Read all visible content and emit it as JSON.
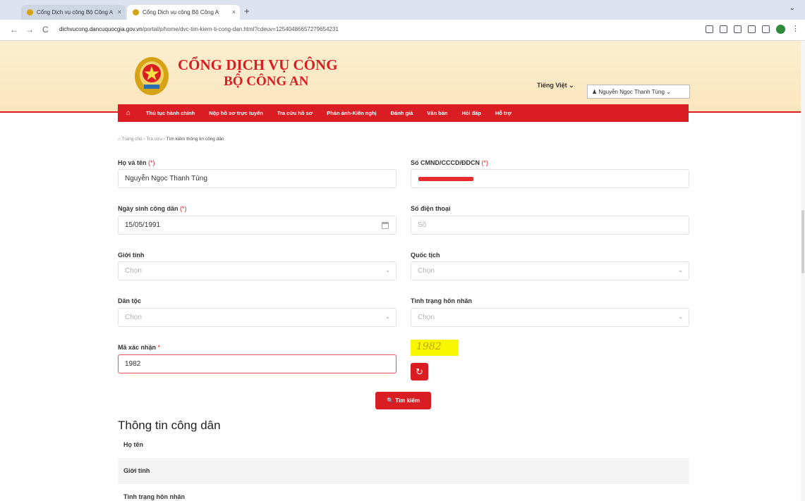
{
  "browser": {
    "tabs": [
      {
        "title": "Cổng Dịch vụ công Bộ Công A"
      },
      {
        "title": "Cổng Dịch vụ công Bộ Công A"
      }
    ],
    "close_glyph": "×",
    "new_tab_glyph": "+",
    "url_host": "dichvucong.dancuquocgia.gov.vn",
    "url_path": "/portal/p/home/dvc-tim-kiem-ti-cong-dan.html?cdeuv=12540486657279654231",
    "back_glyph": "←",
    "forward_glyph": "→",
    "reload_glyph": "C",
    "menu_glyph": "⌄"
  },
  "site": {
    "title_line1": "CỔNG DỊCH VỤ CÔNG",
    "title_line2": "BỘ CÔNG AN",
    "language": "Tiếng Việt ⌄",
    "user": "♟ Nguyễn Ngọc Thanh Tùng ⌄",
    "colors": {
      "brand_red": "#d91d23",
      "header_bg": "#fbeed0",
      "captcha_bg": "#f9f700"
    }
  },
  "nav": {
    "home_icon": "⌂",
    "items": [
      "Thủ tục hành chính",
      "Nộp hồ sơ trực tuyến",
      "Tra cứu hồ sơ",
      "Phản ánh-Kiến nghị",
      "Đánh giá",
      "Văn bản",
      "Hỏi đáp",
      "Hỗ trợ"
    ]
  },
  "breadcrumb": {
    "home": "⌂ Trang chủ",
    "sep": "›",
    "level2": "Tra cứu",
    "current": "Tìm kiếm thông tin công dân"
  },
  "form": {
    "full_name": {
      "label": "Họ và tên",
      "required_mark": "(*)",
      "value": "Nguyễn Ngọc Thanh Tùng"
    },
    "id_number": {
      "label": "Số CMND/CCCD/ĐDCN",
      "required_mark": "(*)"
    },
    "birth_date": {
      "label": "Ngày sinh công dân",
      "required_mark": "(*)",
      "value": "15/05/1991"
    },
    "phone": {
      "label": "Số điện thoại",
      "placeholder": "Số"
    },
    "gender": {
      "label": "Giới tính",
      "placeholder": "Chọn"
    },
    "nationality": {
      "label": "Quốc tịch",
      "placeholder": "Chọn"
    },
    "ethnicity": {
      "label": "Dân tộc",
      "placeholder": "Chọn"
    },
    "marital_status": {
      "label": "Tình trạng hôn nhân",
      "placeholder": "Chọn"
    },
    "captcha": {
      "label": "Mã xác nhận",
      "required_mark": "*",
      "value": "1982",
      "image_text": "1982"
    },
    "chevron": "⌄",
    "refresh_icon": "↻",
    "search_button": "🔍 Tìm kiếm"
  },
  "info": {
    "title": "Thông tin công dân",
    "rows": [
      "Họ tên",
      "Giới tính",
      "Tình trạng hôn nhân"
    ]
  }
}
